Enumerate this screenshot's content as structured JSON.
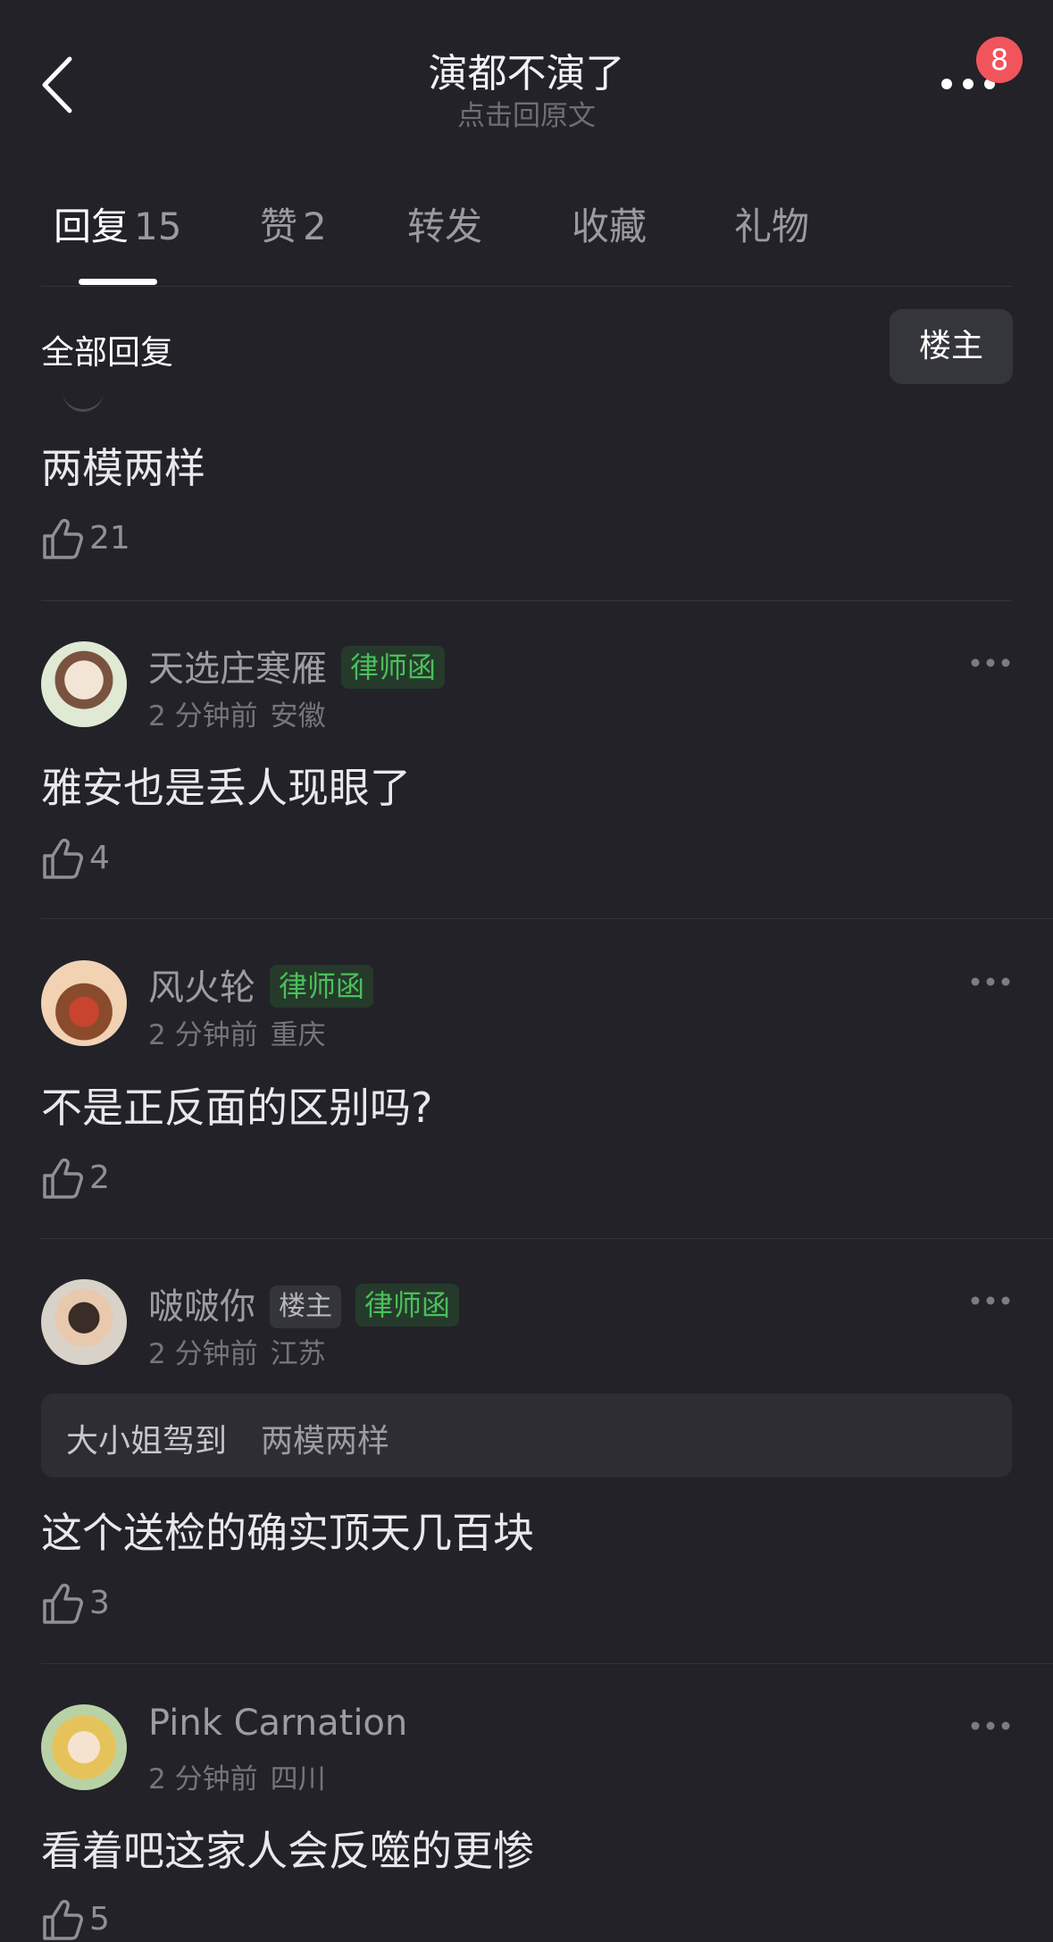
{
  "header": {
    "title": "演都不演了",
    "subtitle": "点击回原文",
    "badge": "8"
  },
  "tabs": [
    {
      "label": "回复",
      "count": "15"
    },
    {
      "label": "赞",
      "count": "2"
    },
    {
      "label": "转发",
      "count": ""
    },
    {
      "label": "收藏",
      "count": ""
    },
    {
      "label": "礼物",
      "count": ""
    }
  ],
  "subheader": {
    "title": "全部回复",
    "filter": "楼主"
  },
  "comments": [
    {
      "content": "两模两样",
      "likes": "21"
    },
    {
      "user": "天选庄寒雁",
      "tag": "律师函",
      "time": "2 分钟前",
      "location": "安徽",
      "content": "雅安也是丢人现眼了",
      "likes": "4"
    },
    {
      "user": "风火轮",
      "tag": "律师函",
      "time": "2 分钟前",
      "location": "重庆",
      "content": "不是正反面的区别吗?",
      "likes": "2"
    },
    {
      "user": "啵啵你",
      "host_tag": "楼主",
      "tag": "律师函",
      "time": "2 分钟前",
      "location": "江苏",
      "quote": {
        "user": "大小姐驾到",
        "text": "两模两样"
      },
      "content": "这个送检的确实顶天几百块",
      "likes": "3"
    },
    {
      "user": "Pink Carnation",
      "time": "2 分钟前",
      "location": "四川",
      "content": "看着吧这家人会反噬的更惨",
      "likes": "5"
    }
  ],
  "colors": {
    "background": "#222228",
    "badge": "#f2545b",
    "tag_green": "#49c05b"
  }
}
